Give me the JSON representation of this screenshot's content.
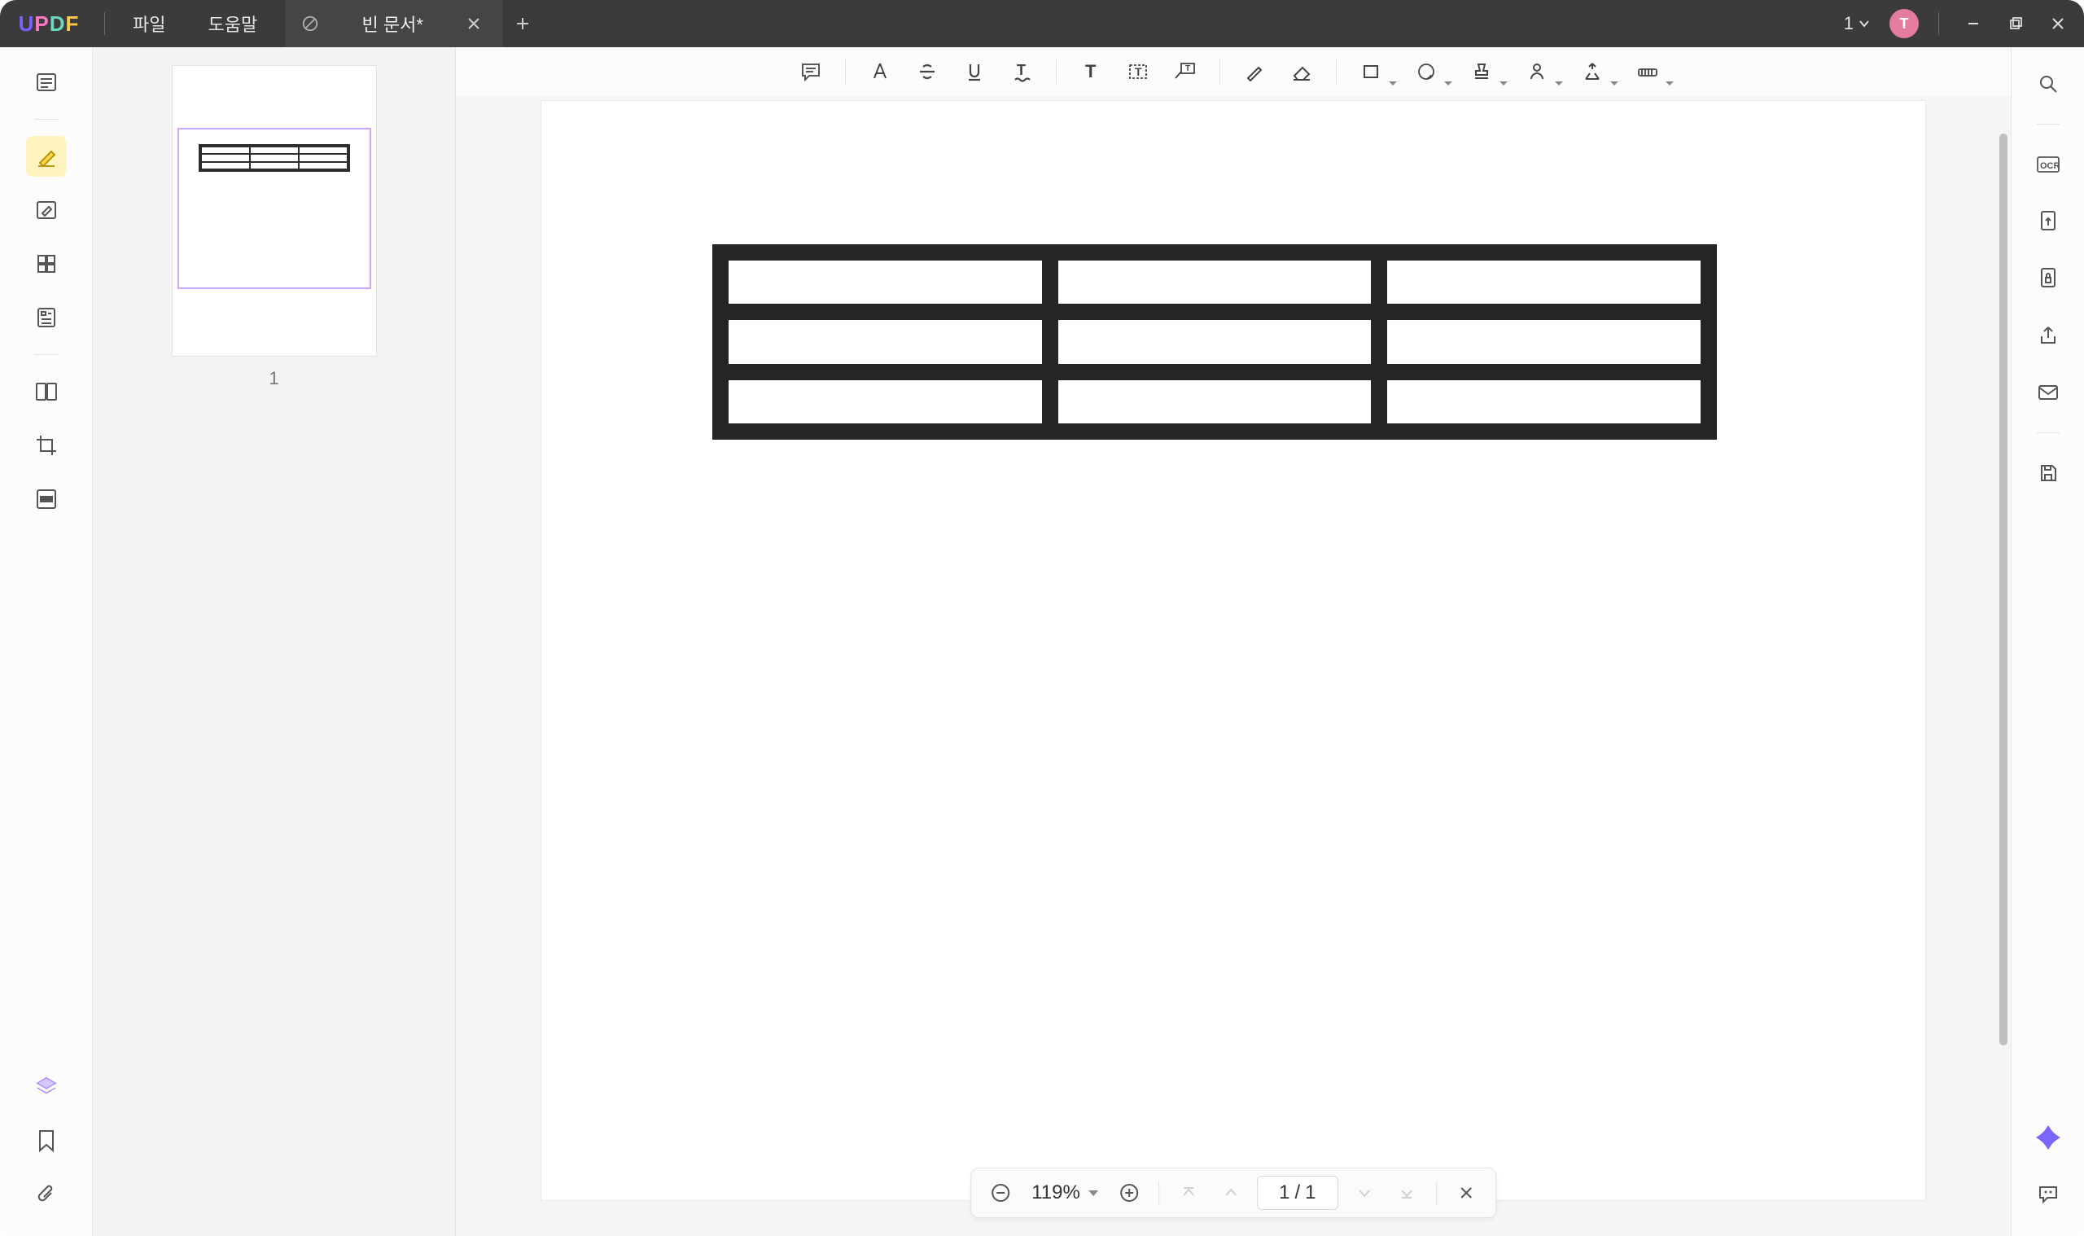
{
  "app": {
    "name": "UPDF"
  },
  "menu": {
    "file": "파일",
    "help": "도움말"
  },
  "tab": {
    "title": "빈 문서*",
    "close": "×",
    "add": "+",
    "icon": "edit-disabled-icon"
  },
  "titlebar": {
    "count": "1",
    "avatar": "T"
  },
  "left_rail": {
    "buttons": [
      {
        "name": "reader-mode-icon"
      },
      {
        "name": "highlighter-icon",
        "active": true
      },
      {
        "name": "edit-text-icon"
      },
      {
        "name": "page-manage-icon"
      },
      {
        "name": "form-icon"
      },
      {
        "name": "compare-icon"
      },
      {
        "name": "crop-icon"
      },
      {
        "name": "redact-icon"
      }
    ],
    "bottom": [
      {
        "name": "layers-icon"
      },
      {
        "name": "bookmark-icon"
      },
      {
        "name": "attachment-icon"
      }
    ]
  },
  "thumbnails": {
    "page1_label": "1"
  },
  "anno_toolbar": [
    {
      "name": "note-icon"
    },
    {
      "name": "highlight-text-icon"
    },
    {
      "name": "strikethrough-icon"
    },
    {
      "name": "underline-icon"
    },
    {
      "name": "squiggly-icon"
    },
    {
      "sep": true
    },
    {
      "name": "text-icon"
    },
    {
      "name": "textbox-icon"
    },
    {
      "name": "callout-icon"
    },
    {
      "sep": true
    },
    {
      "name": "pencil-icon"
    },
    {
      "name": "eraser-icon"
    },
    {
      "sep": true
    },
    {
      "name": "shape-rect-icon",
      "dd": true
    },
    {
      "name": "sticker-icon",
      "dd": true
    },
    {
      "name": "stamp-icon",
      "dd": true
    },
    {
      "name": "signature-icon",
      "dd": true
    },
    {
      "name": "measure-icon",
      "dd": true
    },
    {
      "name": "more-tools-icon",
      "dd": true
    }
  ],
  "document": {
    "table": {
      "rows": 3,
      "cols": 3
    }
  },
  "right_rail": {
    "top": [
      {
        "name": "search-icon"
      }
    ],
    "group": [
      {
        "name": "ocr-icon"
      },
      {
        "name": "convert-icon"
      },
      {
        "name": "protect-icon"
      },
      {
        "name": "share-icon"
      },
      {
        "name": "email-icon"
      }
    ],
    "group2": [
      {
        "name": "save-icon"
      }
    ],
    "bottom": [
      {
        "name": "ai-assistant-icon"
      },
      {
        "name": "feedback-icon"
      }
    ]
  },
  "pagenav": {
    "zoom": "119%",
    "current": "1",
    "sep": "/",
    "total": "1"
  }
}
